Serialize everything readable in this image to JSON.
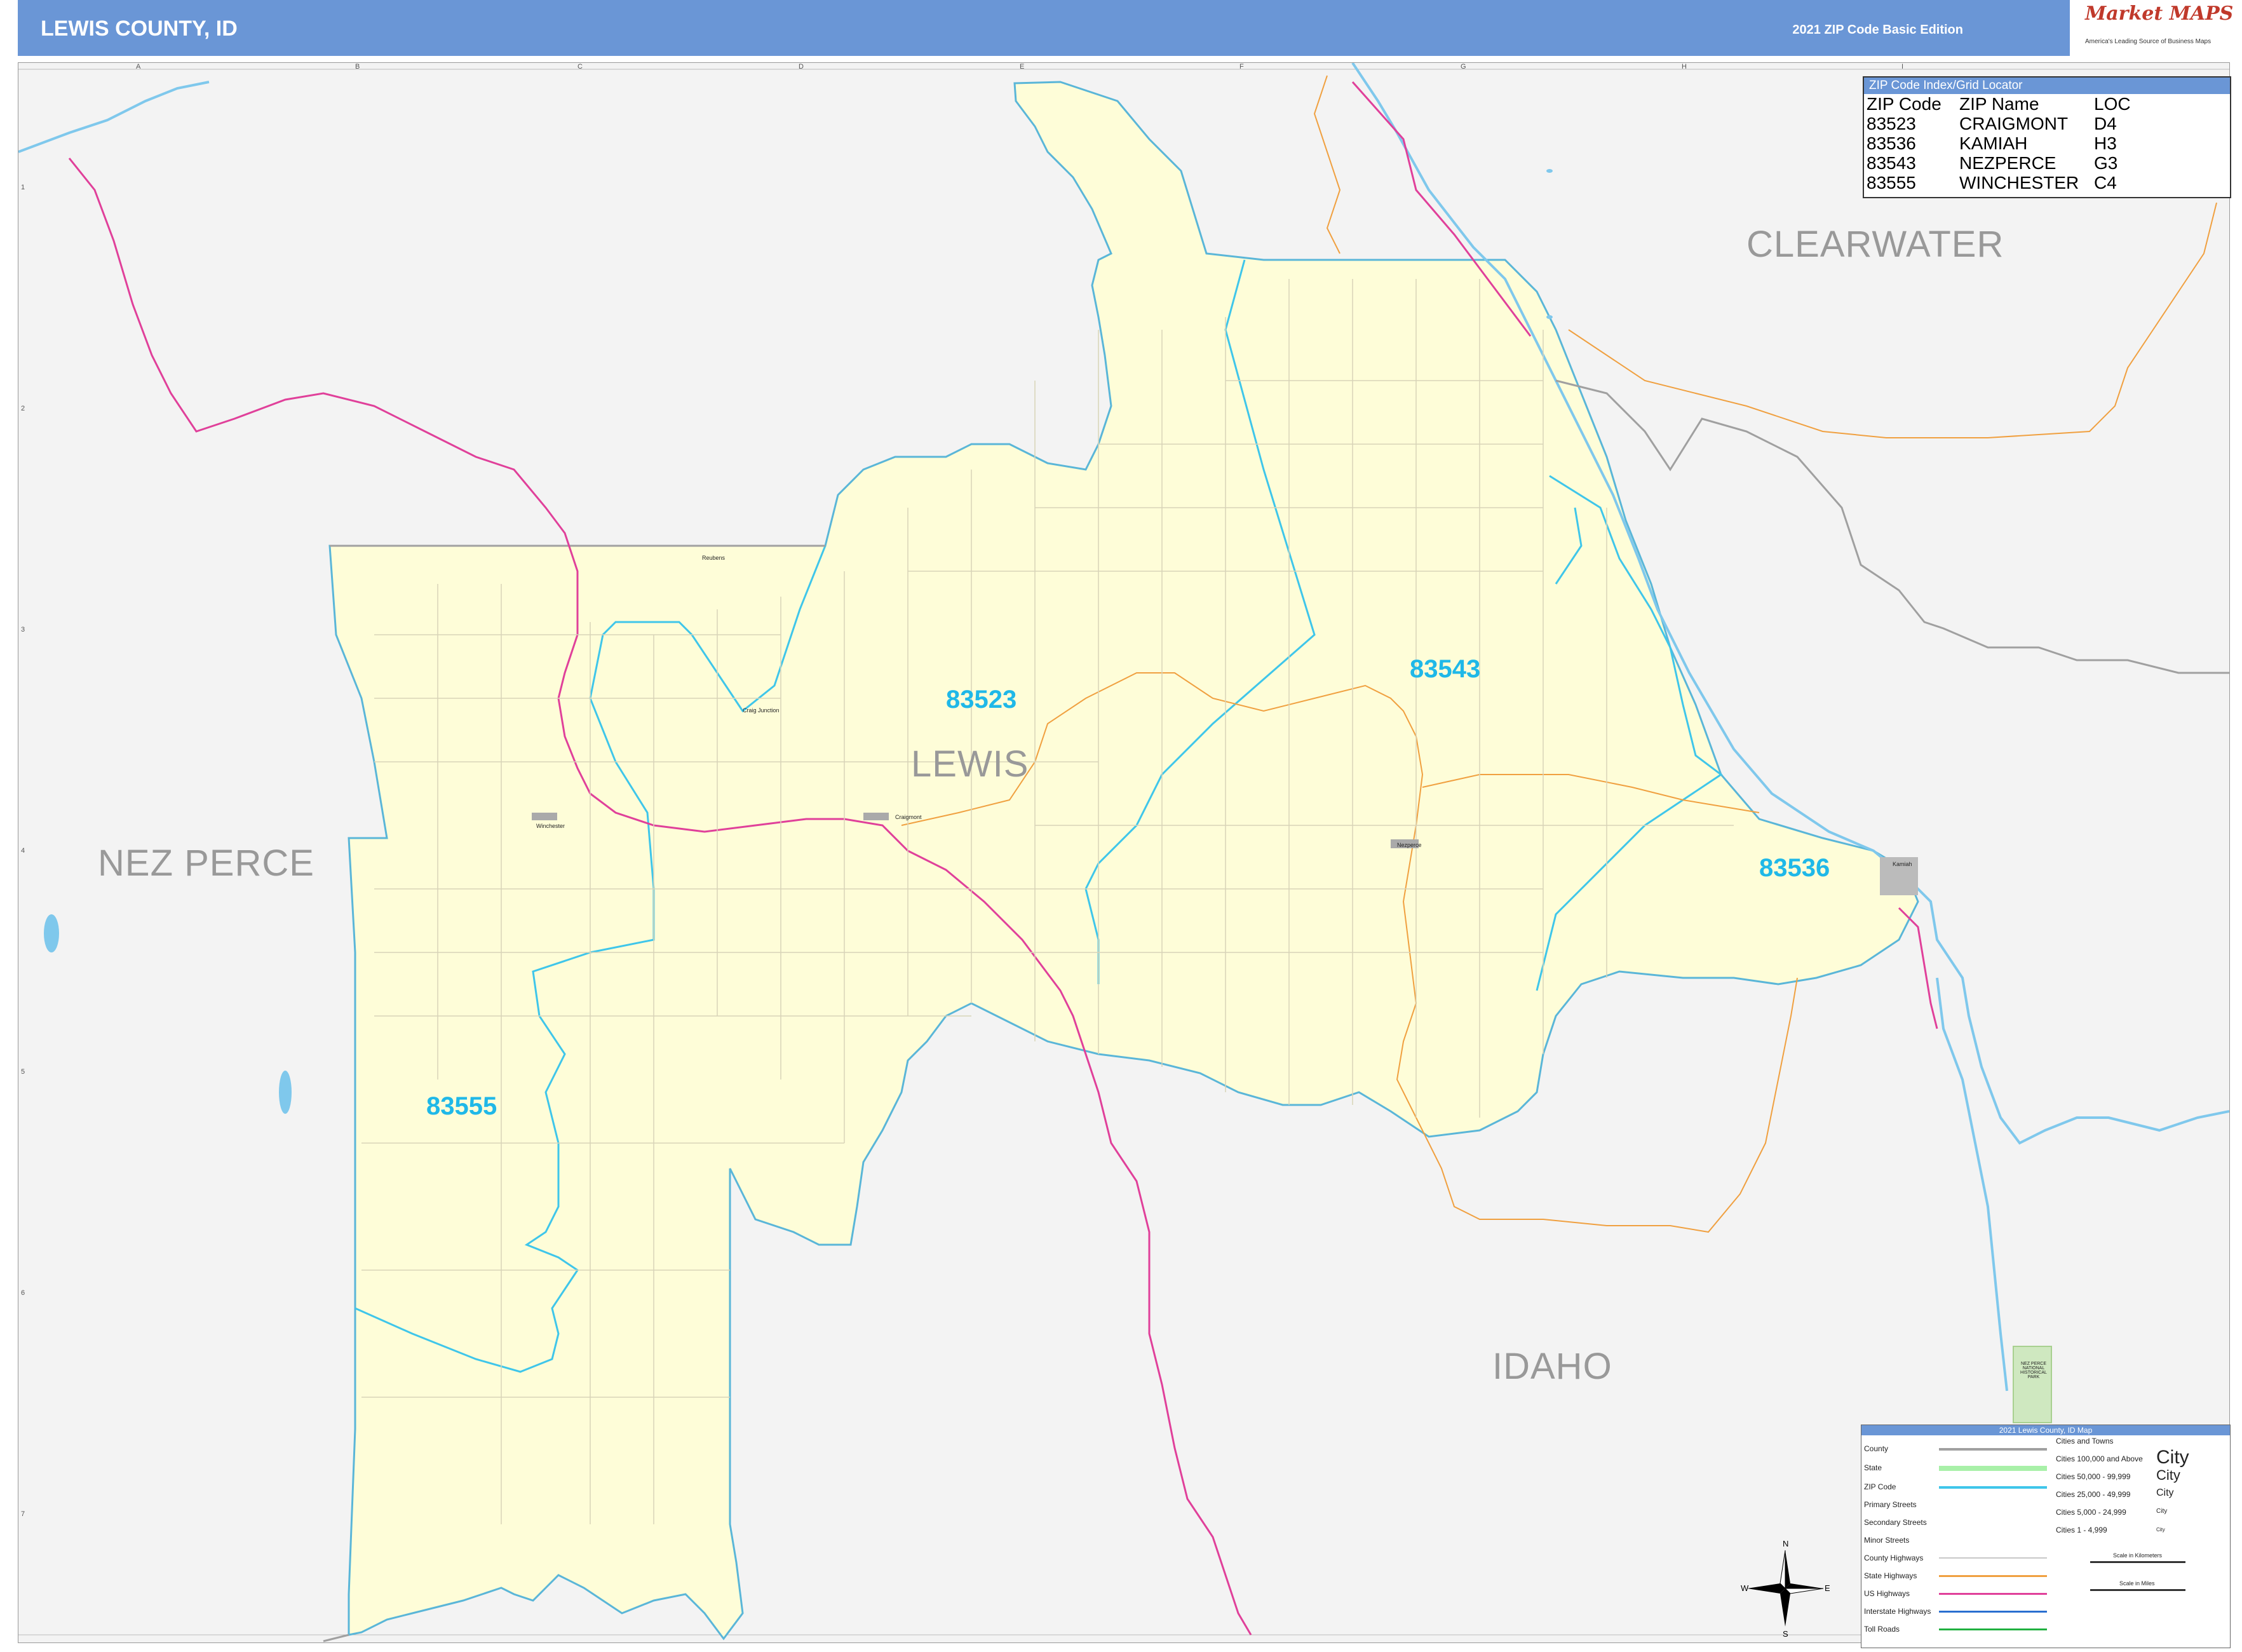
{
  "header": {
    "title": "LEWIS COUNTY, ID",
    "edition": "2021 ZIP Code Basic Edition",
    "logo_name": "Market MAPS",
    "logo_tagline": "America's Leading Source of Business Maps"
  },
  "regions": {
    "clearwater": "CLEARWATER",
    "nez_perce": "NEZ PERCE",
    "lewis": "LEWIS",
    "idaho": "IDAHO"
  },
  "zip_labels": {
    "z83523": "83523",
    "z83543": "83543",
    "z83536": "83536",
    "z83555": "83555"
  },
  "cities": {
    "winchester": "Winchester",
    "craigmont": "Craigmont",
    "nezperce": "Nezperce",
    "kamiah": "Kamiah",
    "craig_junction": "Craig Junction",
    "reubens": "Reubens",
    "nez_perce_park": "NEZ PERCE NATIONAL HISTORICAL PARK"
  },
  "grid": {
    "columns": [
      "A",
      "B",
      "C",
      "D",
      "E",
      "F",
      "G",
      "H",
      "I"
    ],
    "rows": [
      "1",
      "2",
      "3",
      "4",
      "5",
      "6",
      "7"
    ]
  },
  "zip_index": {
    "title": "ZIP Code Index/Grid Locator",
    "headers": [
      "ZIP Code",
      "ZIP Name",
      "LOC"
    ],
    "rows": [
      [
        "83523",
        "CRAIGMONT",
        "D4"
      ],
      [
        "83536",
        "KAMIAH",
        "H3"
      ],
      [
        "83543",
        "NEZPERCE",
        "G3"
      ],
      [
        "83555",
        "WINCHESTER",
        "C4"
      ]
    ]
  },
  "legend": {
    "title": "2021 Lewis County, ID Map",
    "items": [
      "County",
      "State",
      "ZIP Code",
      "Primary Streets",
      "Secondary Streets",
      "Minor Streets",
      "County Highways",
      "State Highways",
      "US Highways",
      "Interstate Highways",
      "Toll Roads"
    ],
    "cities_header": "Cities and Towns",
    "city_classes": [
      "Cities 100,000 and Above",
      "Cities 50,000 - 99,999",
      "Cities 25,000 - 49,999",
      "Cities 5,000 - 24,999",
      "Cities 1 - 4,999"
    ],
    "city_samples": [
      "City",
      "City",
      "City",
      "City",
      "City"
    ],
    "scale_km": "Scale in Kilometers",
    "scale_mi": "Scale in Miles",
    "colors": {
      "county": "#a0a0a0",
      "state": "#a8f0a8",
      "zip": "#3fc6ea",
      "state_hwy": "#f0a040",
      "us_hwy": "#e0409a",
      "interstate": "#2a6fd0",
      "toll": "#20b040"
    }
  },
  "compass": {
    "n": "N",
    "s": "S",
    "e": "E",
    "w": "W"
  },
  "colors": {
    "header": "#6a96d6",
    "county_fill": "#fefdd8",
    "zip_boundary": "#3fc6ea",
    "zip_label": "#1fb8e8",
    "water": "#7fc8ec",
    "us_highway": "#e0409a",
    "state_highway": "#f0a040",
    "county_line": "#a0a0a0"
  }
}
